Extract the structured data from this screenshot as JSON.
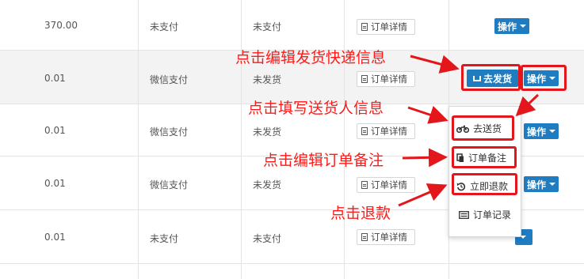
{
  "rows": [
    {
      "amount": "370.00",
      "pay_method": "未支付",
      "status": "未支付"
    },
    {
      "amount": "0.01",
      "pay_method": "微信支付",
      "status": "未发货"
    },
    {
      "amount": "0.01",
      "pay_method": "微信支付",
      "status": "未发货"
    },
    {
      "amount": "0.01",
      "pay_method": "微信支付",
      "status": "未发货"
    },
    {
      "amount": "0.01",
      "pay_method": "未支付",
      "status": "未支付"
    }
  ],
  "detail_label": "订单详情",
  "op_label": "操作",
  "ship_label": "去发货",
  "menu": {
    "deliver": "去送货",
    "remark": "订单备注",
    "refund": "立即退款",
    "record": "订单记录"
  },
  "annotations": {
    "edit_shipping": "点击编辑发货快递信息",
    "fill_sender": "点击填写送货人信息",
    "edit_remark": "点击编辑订单备注",
    "refund": "点击退款"
  },
  "colors": {
    "primary_button": "#1f7cc1",
    "annotation_red": "#e3161b"
  }
}
